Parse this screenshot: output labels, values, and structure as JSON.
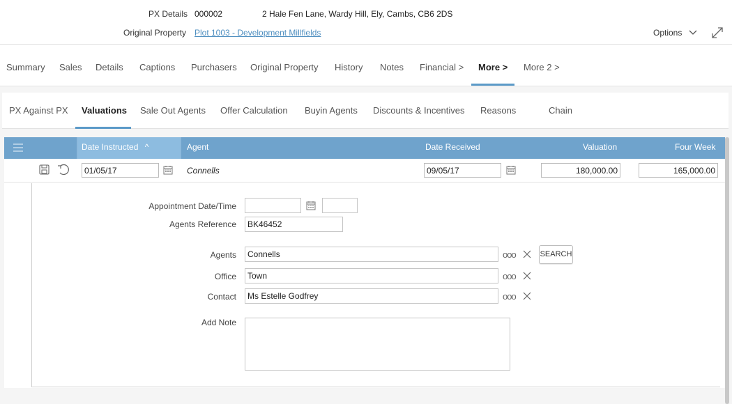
{
  "header": {
    "px_details_label": "PX Details",
    "px_details_value": "000002",
    "address": "2 Hale Fen Lane, Wardy Hill, Ely, Cambs, CB6 2DS",
    "original_property_label": "Original Property",
    "original_property_link": "Plot 1003 - Development Millfields",
    "options_label": "Options"
  },
  "main_tabs": [
    "Summary",
    "Sales",
    "Details",
    "Captions",
    "Purchasers",
    "Original Property",
    "History",
    "Notes",
    "Financial >",
    "More >",
    "More 2 >"
  ],
  "main_tab_active": "More >",
  "sub_tabs": [
    "PX Against PX",
    "Valuations",
    "Sale Out Agents",
    "Offer Calculation",
    "Buyin Agents",
    "Discounts & Incentives",
    "Reasons",
    "Chain"
  ],
  "sub_tab_active": "Valuations",
  "grid": {
    "columns": {
      "date_instructed": "Date Instructed",
      "agent": "Agent",
      "date_received": "Date Received",
      "valuation": "Valuation",
      "four_week": "Four Week"
    },
    "sort_indicator": "^",
    "row": {
      "date_instructed": "01/05/17",
      "agent": "Connells",
      "date_received": "09/05/17",
      "valuation": "180,000.00",
      "four_week": "165,000.00"
    }
  },
  "detail": {
    "appointment_label": "Appointment Date/Time",
    "appointment_date": "",
    "appointment_time": "",
    "agents_reference_label": "Agents Reference",
    "agents_reference": "BK46452",
    "agents_label": "Agents",
    "agents_value": "Connells",
    "office_label": "Office",
    "office_value": "Town",
    "contact_label": "Contact",
    "contact_value": "Ms Estelle Godfrey",
    "search_button": "SEARCH",
    "add_note_label": "Add Note",
    "add_note_value": "",
    "dots": "ooo"
  },
  "colors": {
    "grid_header": "#6fa3cc",
    "sorted_column": "#8dbce0",
    "accent": "#5b9ac8",
    "link": "#4f8fc0"
  },
  "icons": [
    "menu-icon",
    "save-icon",
    "undo-icon",
    "calendar-icon",
    "chevron-down-icon",
    "expand-icon",
    "ellipsis-icon",
    "close-icon"
  ]
}
